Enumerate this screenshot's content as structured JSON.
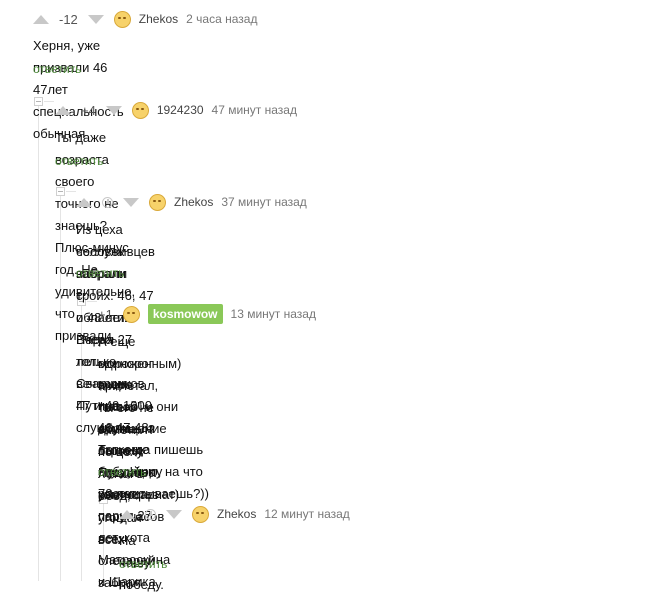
{
  "comments": [
    {
      "rating": "-12",
      "username": "Zhekos",
      "time": "2 часа назад",
      "text": [
        "Херня, уже призвали 46 47лет специальность обычная"
      ],
      "reply": "ответить"
    },
    {
      "rating": "+4",
      "username": "1924230",
      "time": "47 минут назад",
      "text": [
        "Ты даже возраста своего точного не знаешь? Плюс-минус год. Не удивительно, что призвали."
      ],
      "reply": "ответить"
    },
    {
      "username": "Zhekos",
      "time": "37 минут назад",
      "text": [
        "Из цеха сослуживцев забрали троих. 46, 47 и 48 лет. Парня 27 лет. Сварщиков 47 и 49.1000",
        "человек набрали с области. Вчера только вечером Путина слушали."
      ],
      "reply": "ответить"
    },
    {
      "rating": "+1",
      "username": "kosmowow",
      "time": "13 минут назад",
      "text": [
        "А еще единорог прилетал, ты его не заметил? по цеху летал в обед, угощал всех",
        "мороженным)",
        "вчера только обращение было Путина, а уже через пару часов всех слесарей забрал",
        "\"запой\" и они дружным строем пошли в комиссариат)",
        "46,47,48 лет, еще бабу Нюру 70 лет, парня 27 лет, кота Матроскина и Шарика.",
        "Ты когда пишешь эту хуйню, на что рассчитываешь?))"
      ],
      "reply": "ответить"
    },
    {
      "username": "Zhekos",
      "time": "12 минут назад",
      "text": [
        "На нашу победу."
      ],
      "reply": "ответить"
    }
  ],
  "colors": {
    "reply_link": "#4f8a3c",
    "badge": "#8ac858",
    "vote_arrow": "#c8c8c8"
  },
  "icons": [
    "upvote-arrow-icon",
    "downvote-arrow-icon",
    "clock-icon",
    "avatar-icon",
    "collapse-icon"
  ]
}
